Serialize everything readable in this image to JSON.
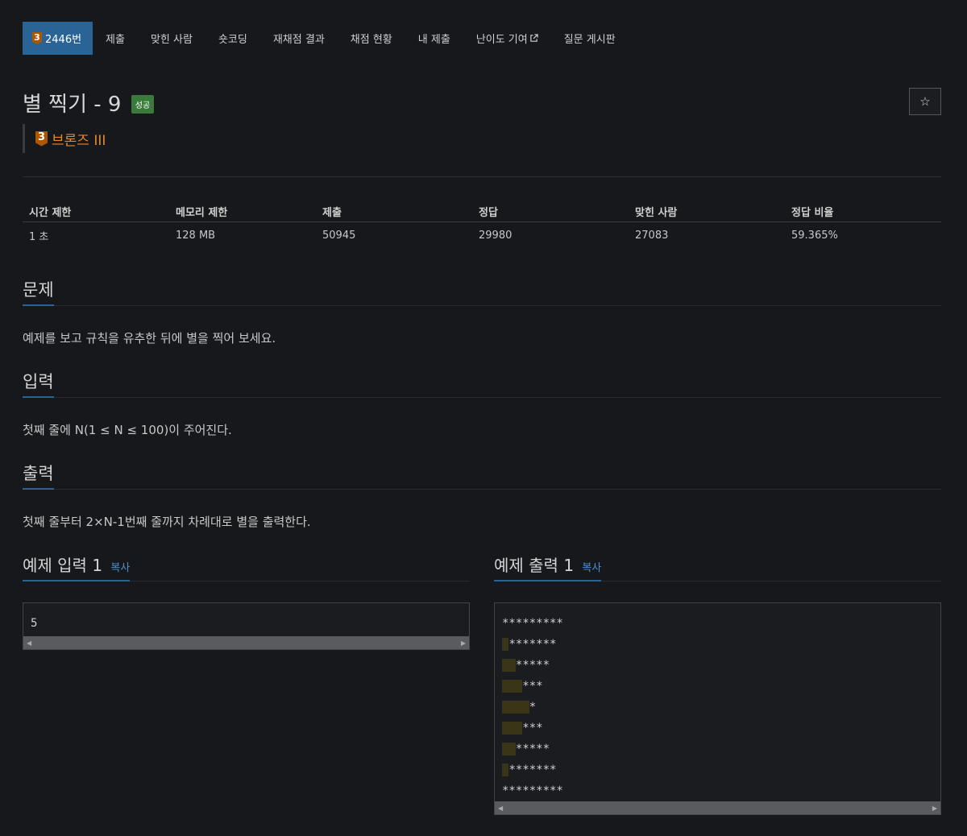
{
  "nav": {
    "problem_number": "2446번",
    "tier_digit": "3",
    "items": [
      "제출",
      "맞힌 사람",
      "숏코딩",
      "재채점 결과",
      "채점 현황",
      "내 제출",
      "난이도 기여",
      "질문 게시판"
    ]
  },
  "problem": {
    "title": "별 찍기 - 9",
    "status": "성공",
    "star": "☆",
    "tier_digit": "3",
    "tier_name": "브론즈 III"
  },
  "info": {
    "headers": [
      "시간 제한",
      "메모리 제한",
      "제출",
      "정답",
      "맞힌 사람",
      "정답 비율"
    ],
    "values": [
      "1 초",
      "128 MB",
      "50945",
      "29980",
      "27083",
      "59.365%"
    ]
  },
  "sections": {
    "description": {
      "title": "문제",
      "text": "예제를 보고 규칙을 유추한 뒤에 별을 찍어 보세요."
    },
    "input": {
      "title": "입력",
      "text": "첫째 줄에 N(1 ≤ N ≤ 100)이 주어진다."
    },
    "output": {
      "title": "출력",
      "text": "첫째 줄부터 2×N-1번째 줄까지 차례대로 별을 출력한다."
    }
  },
  "samples": {
    "input_title": "예제 입력 1",
    "output_title": "예제 출력 1",
    "copy_label": "복사",
    "input_value": "5",
    "output_lines": [
      {
        "spaces": "",
        "stars": "*********"
      },
      {
        "spaces": " ",
        "stars": "*******"
      },
      {
        "spaces": "  ",
        "stars": "*****"
      },
      {
        "spaces": "   ",
        "stars": "***"
      },
      {
        "spaces": "    ",
        "stars": "*"
      },
      {
        "spaces": "   ",
        "stars": "***"
      },
      {
        "spaces": "  ",
        "stars": "*****"
      },
      {
        "spaces": " ",
        "stars": "*******"
      },
      {
        "spaces": "",
        "stars": "*********"
      }
    ]
  },
  "colors": {
    "background": "#17181b",
    "active_tab": "#2a6496",
    "bronze": "#ad5600",
    "success": "#3a7a3a",
    "link": "#4a8fd0"
  }
}
